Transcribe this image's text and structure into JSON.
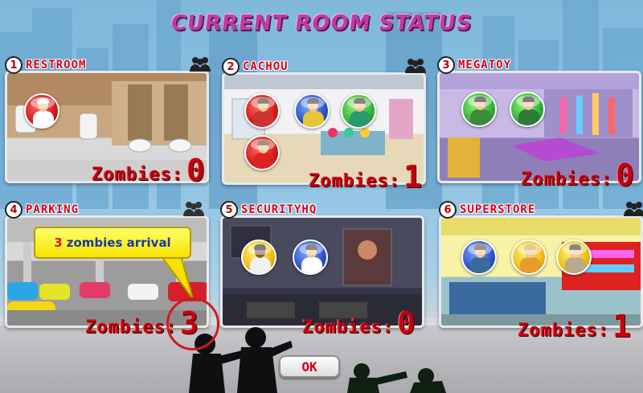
{
  "screen": {
    "title": "Current Room Status"
  },
  "rooms": [
    {
      "number": "1",
      "name": "Restroom",
      "zombie_label": "Zombies:",
      "zombie_count": "0",
      "scene": "restroom",
      "characters": [
        "red"
      ]
    },
    {
      "number": "2",
      "name": "Cachou",
      "zombie_label": "Zombies:",
      "zombie_count": "1",
      "scene": "cachou",
      "characters": [
        "red",
        "blue",
        "green",
        "red"
      ]
    },
    {
      "number": "3",
      "name": "Megatoy",
      "zombie_label": "Zombies:",
      "zombie_count": "0",
      "scene": "megatoy",
      "characters": [
        "green",
        "green"
      ]
    },
    {
      "number": "4",
      "name": "Parking",
      "zombie_label": "Zombies:",
      "zombie_count": "3",
      "scene": "parking",
      "characters": []
    },
    {
      "number": "5",
      "name": "SecurityHQ",
      "zombie_label": "Zombies:",
      "zombie_count": "0",
      "scene": "security",
      "characters": [
        "yellow",
        "blue"
      ]
    },
    {
      "number": "6",
      "name": "Superstore",
      "zombie_label": "Zombies:",
      "zombie_count": "1",
      "scene": "superstore",
      "characters": [
        "blue",
        "yellow",
        "yellow"
      ]
    }
  ],
  "callout": {
    "count": "3",
    "text": "zombies arrival"
  },
  "ok_button": {
    "label": "OK"
  },
  "icons": {
    "group": "group-people-icon"
  },
  "colors": {
    "title": "#c23aa6",
    "room_name": "#d3001a",
    "zombie_text": "#c4000f",
    "callout_bg": "#f7e200",
    "callout_text": "#1a3a9a"
  }
}
